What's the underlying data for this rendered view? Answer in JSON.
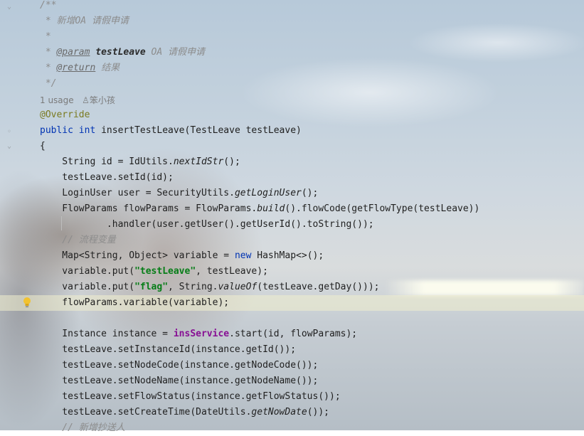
{
  "editor": {
    "lines": [
      {
        "id": "l1",
        "text": "/**"
      },
      {
        "id": "l2",
        "text": " * 新增OA 请假申请"
      },
      {
        "id": "l3",
        "text": " *"
      },
      {
        "id": "l4a",
        "text": " * "
      },
      {
        "id": "l4b",
        "text": "@param"
      },
      {
        "id": "l4c",
        "text": "testLeave"
      },
      {
        "id": "l4d",
        "text": " OA 请假申请"
      },
      {
        "id": "l5a",
        "text": " * "
      },
      {
        "id": "l5b",
        "text": "@return"
      },
      {
        "id": "l5c",
        "text": " 结果"
      },
      {
        "id": "l6",
        "text": " */"
      }
    ],
    "usage": {
      "count": "1 usage",
      "author_icon": "user-icon",
      "author": "笨小孩"
    },
    "code": {
      "override": "@Override",
      "sig_public": "public",
      "sig_int": "int",
      "sig_rest": " insertTestLeave(TestLeave testLeave)",
      "open_brace": "{",
      "c1a": "    String id = IdUtils.",
      "c1b": "nextIdStr",
      "c1c": "();",
      "c2": "    testLeave.setId(id);",
      "c3a": "    LoginUser user = SecurityUtils.",
      "c3b": "getLoginUser",
      "c3c": "();",
      "c4a": "    FlowParams flowParams = FlowParams.",
      "c4b": "build",
      "c4c": "().flowCode(getFlowType(testLeave))",
      "c5": "            .handler(user.getUser().getUserId().toString());",
      "c6": "    // 流程变量",
      "c7a": "    Map<String, Object> variable = ",
      "c7b": "new",
      "c7c": " HashMap<>();",
      "c8a": "    variable.put(",
      "c8b": "\"testLeave\"",
      "c8c": ", testLeave);",
      "c9a": "    variable.put(",
      "c9b": "\"flag\"",
      "c9c": ", String.",
      "c9d": "valueOf",
      "c9e": "(testLeave.getDay()));",
      "c10": "    flowParams.variable(variable);",
      "c11a": "    Instance instance = ",
      "c11b": "insService",
      "c11c": ".start(id, flowParams);",
      "c12": "    testLeave.setInstanceId(instance.getId());",
      "c13": "    testLeave.setNodeCode(instance.getNodeCode());",
      "c14": "    testLeave.setNodeName(instance.getNodeName());",
      "c15": "    testLeave.setFlowStatus(instance.getFlowStatus());",
      "c16a": "    testLeave.setCreateTime(DateUtils.",
      "c16b": "getNowDate",
      "c16c": "());",
      "c17": "    // 新增抄送人"
    },
    "intention_icon": "lightbulb-icon",
    "fold_icon": "fold-chevron-icon"
  }
}
